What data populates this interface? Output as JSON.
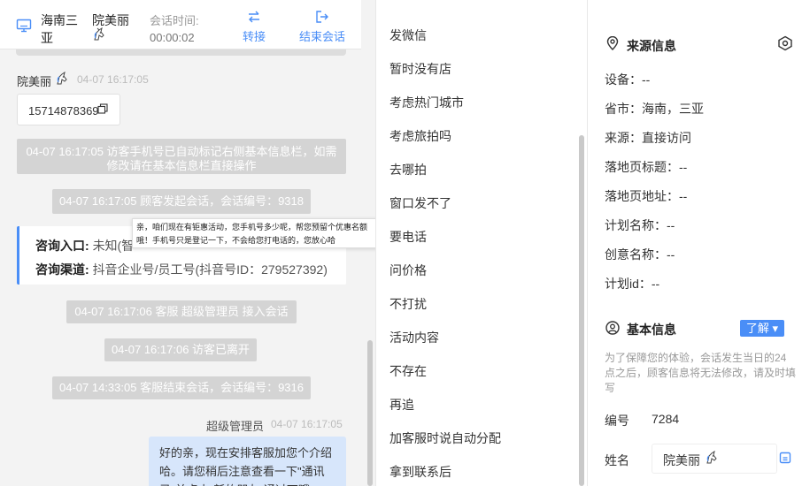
{
  "header": {
    "visitor_name": "海南三亚",
    "agent_name": "院美丽",
    "session_time_label": "会话时间:",
    "session_time_value": "00:00:02",
    "transfer_label": "转接",
    "end_label": "结束会话"
  },
  "chat": {
    "visitor_name": "院美丽",
    "visitor_time": "04-07 16:17:05",
    "phone": "15714878369",
    "system_messages": [
      "04-07 16:17:05 访客手机号已自动标记右侧基本信息栏，如需修改请在基本信息栏直接操作",
      "04-07 16:17:05 顾客发起会话，会话编号：9318",
      "04-07 16:17:06 客服 超级管理员 接入会话",
      "04-07 16:17:06 访客已离开",
      "04-07 14:33:05 客服结束会话，会话编号：9316"
    ],
    "consult_entry_label": "咨询入口:",
    "consult_entry_value": "未知(智",
    "consult_channel_label": "咨询渠道:",
    "consult_channel_value": "抖音企业号/员工号(抖音号ID：279527392)",
    "tooltip": "亲，咱们现在有钜惠活动，您手机号多少呢，帮您预留个优惠名额哦！手机号只是登记一下，不会给您打电话的，您放心哈",
    "agent_name": "超级管理员",
    "agent_time": "04-07 16:17:05",
    "agent_message": "好的亲，现在安排客服加您个介绍哈。请您稍后注意查看一下\"通讯录\"并点击\"新的朋友\"通过下哦"
  },
  "quick_replies": [
    "发微信",
    "暂时没有店",
    "考虑热门城市",
    "考虑旅拍吗",
    "去哪拍",
    "窗口发不了",
    "要电话",
    "问价格",
    "不打扰",
    "活动内容",
    "不存在",
    "再追",
    "加客服时说自动分配",
    "拿到联系后"
  ],
  "source_info": {
    "title": "来源信息",
    "rows": [
      "设备：--",
      "省市：海南，三亚",
      "来源：直接访问",
      "落地页标题：--",
      "落地页地址：--",
      "计划名称：--",
      "创意名称：--",
      "计划id：--"
    ]
  },
  "basic_info": {
    "title": "基本信息",
    "learn_button": "了解 ▾",
    "note": "为了保障您的体验，会话发生当日的24点之后，顾客信息将无法修改，请及时填写",
    "id_label": "编号",
    "id_value": "7284",
    "name_label": "姓名",
    "name_value": "院美丽"
  },
  "colors": {
    "accent": "#4a8ef7",
    "system_bubble": "#d4d4d4",
    "agent_bubble": "#d7e6fb"
  },
  "icons": [
    "monitor-icon",
    "transfer-icon",
    "exit-icon",
    "unicorn-emoji",
    "copy-icon",
    "location-icon",
    "eye-icon",
    "user-icon"
  ]
}
